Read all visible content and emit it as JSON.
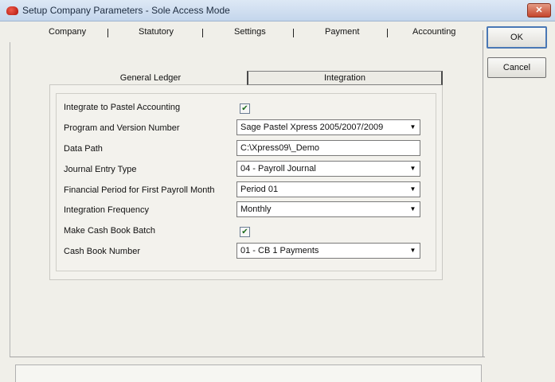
{
  "window": {
    "title": "Setup Company Parameters - Sole Access Mode",
    "close_glyph": "✕"
  },
  "tabs": [
    {
      "label": "Company"
    },
    {
      "label": "Statutory"
    },
    {
      "label": "Settings"
    },
    {
      "label": "Payment"
    },
    {
      "label": "Accounting"
    }
  ],
  "subtabs": {
    "general_ledger": "General Ledger",
    "integration": "Integration"
  },
  "form": {
    "integrate": {
      "label": "Integrate to Pastel Accounting",
      "checked": true
    },
    "program_version": {
      "label": "Program and Version Number",
      "value": "Sage Pastel Xpress 2005/2007/2009"
    },
    "data_path": {
      "label": "Data Path",
      "value": "C:\\Xpress09\\_Demo"
    },
    "journal_entry_type": {
      "label": "Journal Entry Type",
      "value": "04  -  Payroll Journal"
    },
    "financial_period": {
      "label": "Financial Period for First Payroll Month",
      "value": "Period 01"
    },
    "integration_frequency": {
      "label": "Integration Frequency",
      "value": "Monthly"
    },
    "cash_book_batch": {
      "label": "Make Cash Book Batch",
      "checked": true
    },
    "cash_book_number": {
      "label": "Cash Book Number",
      "value": "01  -  CB 1 Payments"
    }
  },
  "buttons": {
    "ok": "OK",
    "cancel": "Cancel"
  },
  "icons": {
    "app": "red-app-icon",
    "checkbox_mark": "✔",
    "dropdown": "▼"
  },
  "colors": {
    "titlebar": "#c4d6ec",
    "close": "#c5462d",
    "window_bg": "#f0efe9"
  }
}
